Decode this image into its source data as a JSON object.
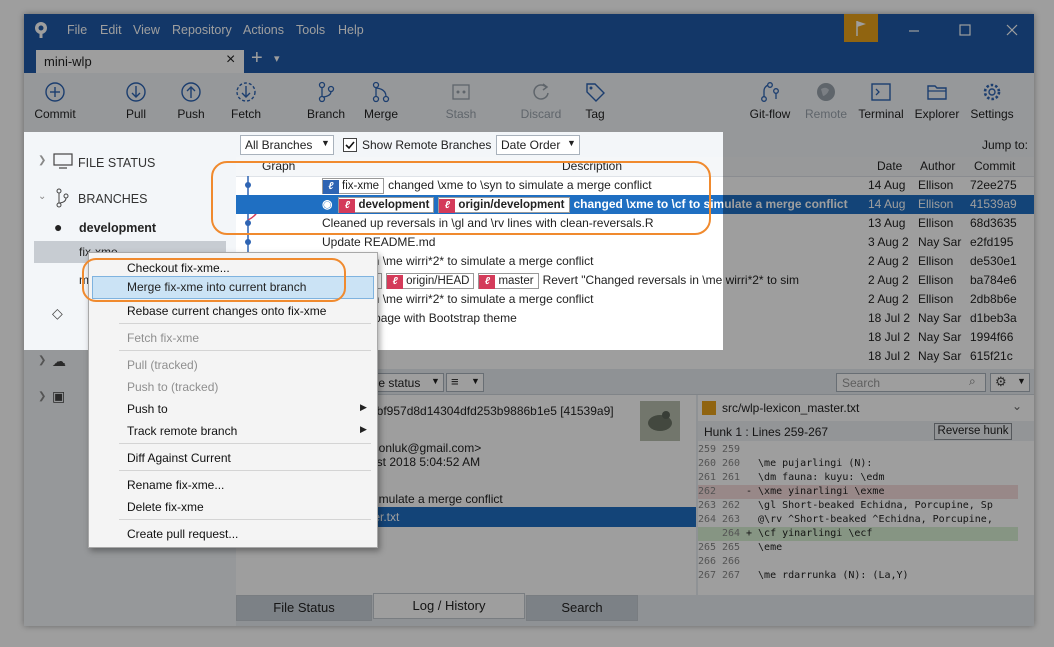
{
  "menu": [
    "File",
    "Edit",
    "View",
    "Repository",
    "Actions",
    "Tools",
    "Help"
  ],
  "tab": {
    "name": "mini-wlp",
    "close": "×",
    "add": "+",
    "more": "▾"
  },
  "toolbar": {
    "commit": "Commit",
    "pull": "Pull",
    "push": "Push",
    "fetch": "Fetch",
    "branch": "Branch",
    "merge": "Merge",
    "stash": "Stash",
    "discard": "Discard",
    "tag": "Tag",
    "gitflow": "Git-flow",
    "remote": "Remote",
    "terminal": "Terminal",
    "explorer": "Explorer",
    "settings": "Settings"
  },
  "filters": {
    "branches": "All Branches",
    "show_remote": "Show Remote Branches",
    "order": "Date Order",
    "jump_to": "Jump to:"
  },
  "sidebar": {
    "file_status": "FILE STATUS",
    "branches": "BRANCHES",
    "current": "development",
    "branch2": "fix-xme",
    "branch3": "m"
  },
  "columns": {
    "graph": "Graph",
    "description": "Description",
    "date": "Date",
    "author": "Author",
    "commit": "Commit"
  },
  "commits": [
    {
      "tags": [
        {
          "name": "fix-xme",
          "c": "blue"
        }
      ],
      "desc": "changed \\xme to \\syn to simulate a merge conflict",
      "date": "14 Aug",
      "author": "Ellison",
      "commit": "72ee275"
    },
    {
      "tags": [
        {
          "name": "development",
          "c": "red"
        },
        {
          "name": "origin/development",
          "c": "red"
        }
      ],
      "desc": "changed \\xme to \\cf to simulate a merge conflict",
      "date": "14 Aug",
      "author": "Ellison",
      "commit": "41539a9"
    },
    {
      "tags": [],
      "desc": "Cleaned up reversals in \\gl and \\rv lines with clean-reversals.R",
      "date": "13 Aug",
      "author": "Ellison",
      "commit": "68d3635"
    },
    {
      "tags": [],
      "desc": "Update README.md",
      "date": "3 Aug 2",
      "author": "Nay Sar",
      "commit": "e2fd195"
    },
    {
      "tags": [],
      "desc": "eversals in \\me wirri*2* to simulate a merge conflict",
      "date": "2 Aug 2",
      "author": "Ellison",
      "commit": "de530e1"
    },
    {
      "tags": [
        {
          "name": "master",
          "c": "red"
        },
        {
          "name": "origin/HEAD",
          "c": "red"
        },
        {
          "name": "master",
          "c": "red"
        }
      ],
      "desc": "Revert \"Changed reversals in \\me wirri*2* to sim",
      "date": "2 Aug 2",
      "author": "Ellison",
      "commit": "ba784e6"
    },
    {
      "tags": [],
      "desc": "eversals in \\me wirri*2* to simulate a merge conflict",
      "date": "2 Aug 2",
      "author": "Ellison",
      "commit": "2db8b6e"
    },
    {
      "tags": [],
      "desc": "ployment page with Bootstrap theme",
      "date": "18 Jul 2",
      "author": "Nay Sar",
      "commit": "d1beb3a"
    },
    {
      "tags": [],
      "desc": "d pipeline",
      "date": "18 Jul 2",
      "author": "Nay Sar",
      "commit": "1994f66"
    },
    {
      "tags": [],
      "desc": "rse stage",
      "date": "18 Jul 2",
      "author": "Nay Sar",
      "commit": "615f21c"
    }
  ],
  "context_menu": {
    "checkout": "Checkout fix-xme...",
    "merge": "Merge fix-xme into current branch",
    "rebase": "Rebase current changes onto fix-xme",
    "fetch": "Fetch fix-xme",
    "pull": "Pull  (tracked)",
    "push_tracked": "Push to  (tracked)",
    "push_to": "Push to",
    "track": "Track remote branch",
    "diff": "Diff Against Current",
    "rename": "Rename fix-xme...",
    "delete": "Delete fix-xme",
    "pr": "Create pull request..."
  },
  "details": {
    "file_status": "ile status",
    "search_placeholder": "Search",
    "hash": "5bf957d8d14304dfd253b9886b1e5 [41539a9]",
    "email": "isonluk@gmail.com>",
    "date": "ust 2018 5:04:52 AM",
    "msg": "simulate a merge conflict",
    "file": "ter.txt"
  },
  "diff": {
    "file": "src/wlp-lexicon_master.txt",
    "hunk": "Hunk 1 : Lines 259-267",
    "reverse": "Reverse hunk",
    "lines": [
      {
        "a": "259",
        "b": "259",
        "t": "",
        "k": "n"
      },
      {
        "a": "260",
        "b": "260",
        "t": "  \\me pujarlingi (N):",
        "k": "n"
      },
      {
        "a": "261",
        "b": "261",
        "t": "  \\dm fauna: kuyu: \\edm",
        "k": "n"
      },
      {
        "a": "262",
        "b": "",
        "t": "- \\xme yinarlingi \\exme",
        "k": "d"
      },
      {
        "a": "263",
        "b": "262",
        "t": "  \\gl Short-beaked Echidna, Porcupine, Sp",
        "k": "n"
      },
      {
        "a": "264",
        "b": "263",
        "t": "  @\\rv ^Short-beaked ^Echidna, Porcupine,",
        "k": "n"
      },
      {
        "a": "",
        "b": "264",
        "t": "+ \\cf yinarlingi \\ecf",
        "k": "a"
      },
      {
        "a": "265",
        "b": "265",
        "t": "  \\eme",
        "k": "n"
      },
      {
        "a": "266",
        "b": "266",
        "t": "",
        "k": "n"
      },
      {
        "a": "267",
        "b": "267",
        "t": "  \\me rdarrunka (N): (La,Y)",
        "k": "n"
      }
    ]
  },
  "bottom_tabs": {
    "file_status": "File Status",
    "log": "Log / History",
    "search": "Search"
  }
}
